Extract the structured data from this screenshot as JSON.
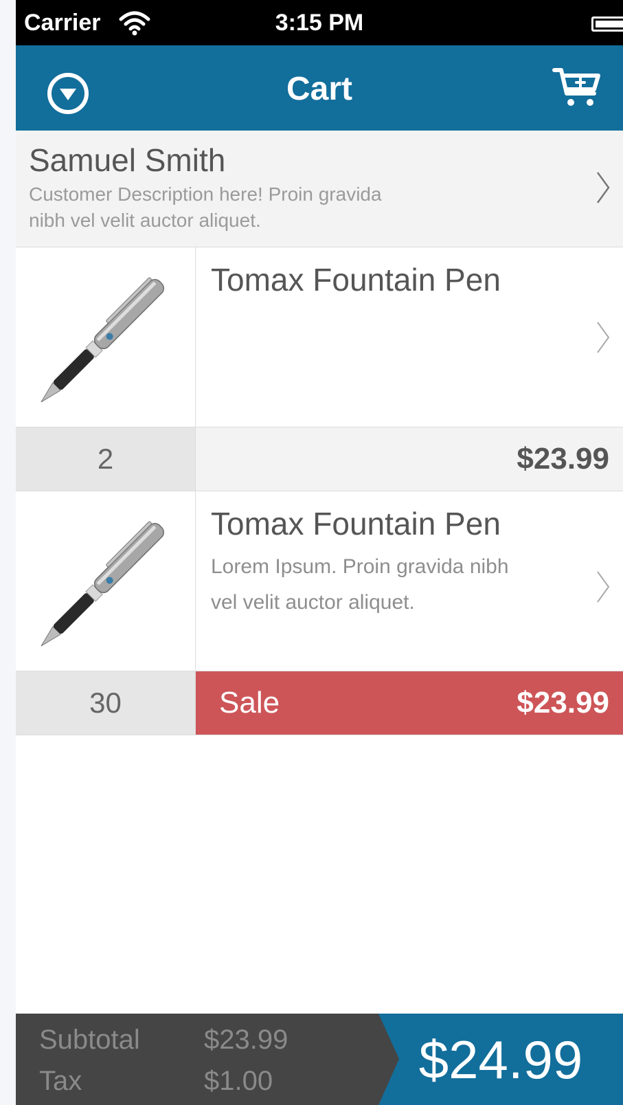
{
  "status_bar": {
    "carrier": "Carrier",
    "time": "3:15 PM"
  },
  "nav": {
    "title": "Cart",
    "left_icon": "circle-down-icon",
    "right_icon": "cart-add-icon"
  },
  "customer": {
    "name": "Samuel Smith",
    "description": "Customer Description here! Proin gravida nibh vel velit auctor aliquet."
  },
  "items": [
    {
      "name": "Tomax Fountain Pen",
      "description": "",
      "quantity": "2",
      "price": "$23.99",
      "sale_label": ""
    },
    {
      "name": "Tomax Fountain Pen",
      "description": "Lorem Ipsum. Proin gravida nibh vel velit auctor aliquet.",
      "quantity": "30",
      "price": "$23.99",
      "sale_label": "Sale"
    }
  ],
  "footer": {
    "subtotal_label": "Subtotal",
    "subtotal_value": "$23.99",
    "tax_label": "Tax",
    "tax_value": "$1.00",
    "total": "$24.99"
  },
  "colors": {
    "brand_blue": "#126e9b",
    "sale_red": "#cd5558",
    "footer_gray": "#454545"
  }
}
